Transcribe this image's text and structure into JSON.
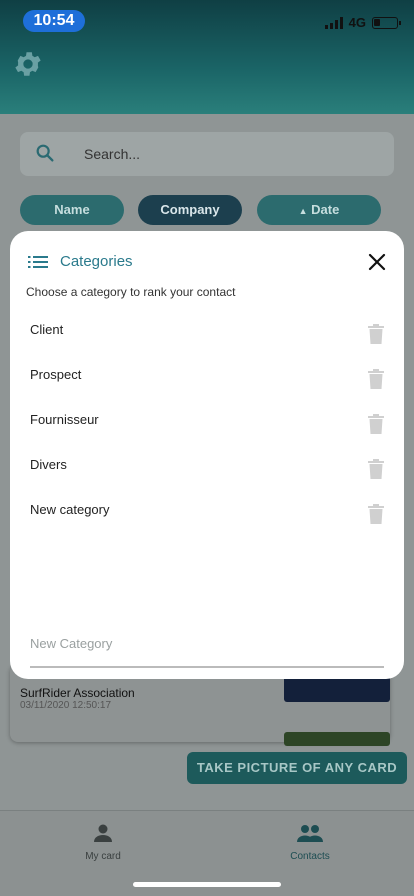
{
  "status_bar": {
    "time": "10:54",
    "network": "4G"
  },
  "search": {
    "placeholder": "Search..."
  },
  "sort_pills": [
    {
      "label": "Name"
    },
    {
      "label": "Company"
    },
    {
      "label": "Date"
    }
  ],
  "background_contact": {
    "name": "SurfRider Association",
    "date": "03/11/2020 12:50:17"
  },
  "take_picture_button": "TAKE PICTURE OF ANY CARD",
  "tabbar": [
    {
      "label": "My card"
    },
    {
      "label": "Contacts"
    }
  ],
  "modal": {
    "title": "Categories",
    "subtitle": "Choose a category to rank your contact",
    "categories": [
      {
        "label": "Client"
      },
      {
        "label": "Prospect"
      },
      {
        "label": "Fournisseur"
      },
      {
        "label": "Divers"
      },
      {
        "label": "New category"
      }
    ],
    "new_category_placeholder": "New Category"
  },
  "colors": {
    "accent": "#2a7a8c",
    "header": "#1a6466",
    "status_time": "#1e6fd9"
  }
}
